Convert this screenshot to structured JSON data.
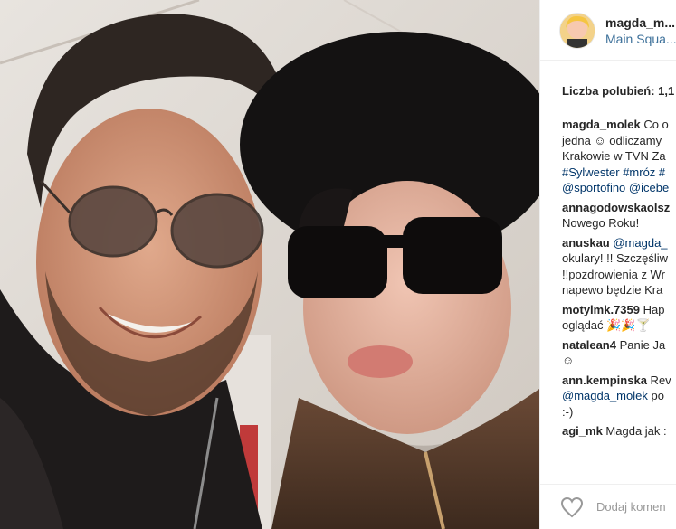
{
  "post": {
    "username": "magda_m...",
    "location": "Main Squa...",
    "likes_text": "Liczba polubień: 1,1",
    "add_comment_placeholder": "Dodaj komen"
  },
  "comments": [
    {
      "user": "magda_molek",
      "lines": [
        {
          "first_rest": " Co o"
        },
        {
          "text": "jedna ☺ odliczamy"
        },
        {
          "text": "Krakowie w TVN Za"
        },
        {
          "tag": "#Sylwester #mróz #"
        },
        {
          "tag": "@sportofino @icebe"
        }
      ]
    },
    {
      "user": "annagodowskaolsz",
      "lines": [
        {
          "first_rest": ""
        },
        {
          "text": "Nowego Roku!"
        }
      ]
    },
    {
      "user": "anuskau",
      "lines": [
        {
          "first_tag": " @magda_"
        },
        {
          "text": "okulary! !! Szczęśliw"
        },
        {
          "text": "!!pozdrowienia z Wr"
        },
        {
          "text": "napewo będzie Kra"
        }
      ]
    },
    {
      "user": "motylmk.7359",
      "lines": [
        {
          "first_rest": " Hap"
        },
        {
          "text": "oglądać 🎉🎉🍸"
        }
      ]
    },
    {
      "user": "natalean4",
      "lines": [
        {
          "first_rest": " Panie Ja"
        },
        {
          "text": "☺"
        }
      ]
    },
    {
      "user": "ann.kempinska",
      "lines": [
        {
          "first_rest": " Rev"
        },
        {
          "tag_rest_tag": "@magda_molek",
          "tag_rest_text": " po"
        },
        {
          "text": ":-)"
        }
      ]
    },
    {
      "user": "agi_mk",
      "lines": [
        {
          "first_rest": " Magda jak :"
        }
      ]
    }
  ],
  "icons": {
    "heart": "heart-outline-icon",
    "avatar": "user-avatar"
  }
}
